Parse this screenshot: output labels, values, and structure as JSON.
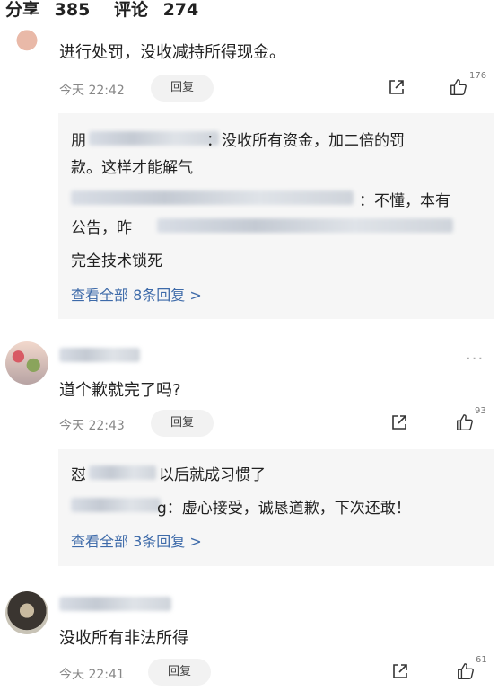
{
  "header": {
    "share_label": "分享",
    "share_count": "385",
    "comment_label": "评论",
    "comment_count": "274"
  },
  "comments": [
    {
      "text": "进行处罚，没收减持所得现金。",
      "time": "今天 22:42",
      "reply_label": "回复",
      "likes": "176",
      "replies": {
        "line1_prefix": "朋",
        "line1_text": "：没收所有资金，加二倍的罚",
        "line2": "款。这样才能解气",
        "line3": "：不懂，本有",
        "line4": "公告，昨",
        "line5": "完全技术锁死",
        "view_all": "查看全部 8条回复 >"
      }
    },
    {
      "text": "道个歉就完了吗?",
      "time": "今天 22:43",
      "reply_label": "回复",
      "likes": "93",
      "replies": {
        "line1_prefix": "怼",
        "line1_text": "以后就成习惯了",
        "line2_suffix": "g：虚心接受，诚恳道歉，下次还敢！",
        "view_all": "查看全部 3条回复 >"
      }
    },
    {
      "text": "没收所有非法所得",
      "time": "今天 22:41",
      "reply_label": "回复",
      "likes": "61"
    }
  ],
  "more_icon": "..."
}
